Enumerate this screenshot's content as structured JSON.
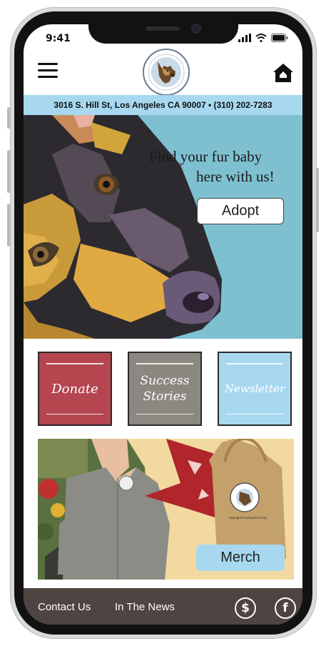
{
  "status": {
    "time": "9:41"
  },
  "header": {
    "menu_icon": "hamburger-menu-icon",
    "logo_icon": "german-shepherd-seal-logo",
    "home_icon": "home-icon"
  },
  "address_bar": {
    "text": "3016 S. Hill St, Los Angeles CA 90007 •  (310) 202-7283"
  },
  "hero": {
    "line1": "Find your fur baby",
    "line2": "here with us!",
    "adopt_label": "Adopt"
  },
  "tiles": [
    {
      "label": "Donate",
      "color": "#b5454f"
    },
    {
      "label": "Success Stories",
      "color": "#8a8880"
    },
    {
      "label": "Newsletter",
      "color": "#a7d8f0"
    }
  ],
  "merch": {
    "label": "Merch",
    "bag_text": "www.germanshepherd.org"
  },
  "footer": {
    "contact_label": "Contact Us",
    "news_label": "In The News",
    "donate_icon": "dollar-icon",
    "social_icon": "facebook-icon"
  },
  "colors": {
    "accent_blue": "#a7d8f0",
    "footer_bg": "#4e4442",
    "hero_bg": "#7ec0d0"
  }
}
